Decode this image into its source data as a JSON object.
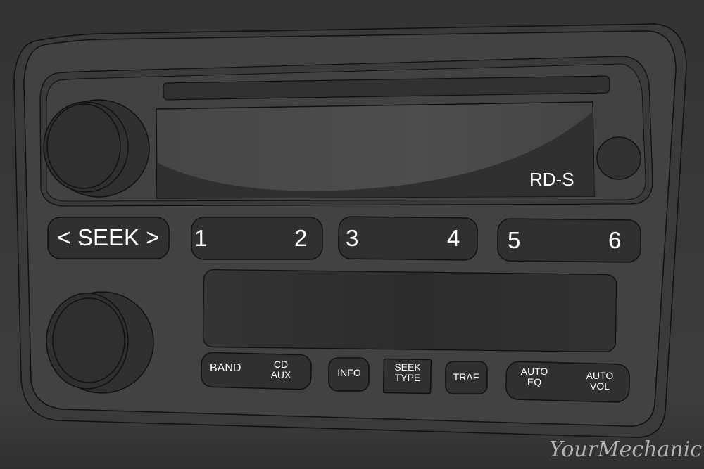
{
  "device": {
    "type": "car-radio-head-unit",
    "display_label": "RD-S"
  },
  "colors": {
    "background": "#363636",
    "bezel": "#424242",
    "button_fill": "#2f2f2f",
    "label_text": "#ffffff",
    "outline": "#111111",
    "watermark": "#b3b3b3"
  },
  "controls": {
    "seek": {
      "label": "< SEEK >"
    },
    "presets": [
      {
        "left": "1",
        "right": "2"
      },
      {
        "left": "3",
        "right": "4"
      },
      {
        "left": "5",
        "right": "6"
      }
    ],
    "band_cd": {
      "left": "BAND",
      "right_line1": "CD",
      "right_line2": "AUX"
    },
    "info": {
      "label": "INFO"
    },
    "seek_type": {
      "line1": "SEEK",
      "line2": "TYPE"
    },
    "traf": {
      "label": "TRAF"
    },
    "auto": {
      "left_line1": "AUTO",
      "left_line2": "EQ",
      "right_line1": "AUTO",
      "right_line2": "VOL"
    }
  },
  "icons": {
    "top_knob": "volume-knob-icon",
    "bottom_knob": "tune-knob-icon",
    "eject_button": "round-button-icon",
    "cd_slot": "cd-slot-icon"
  },
  "watermark": "YourMechanic"
}
